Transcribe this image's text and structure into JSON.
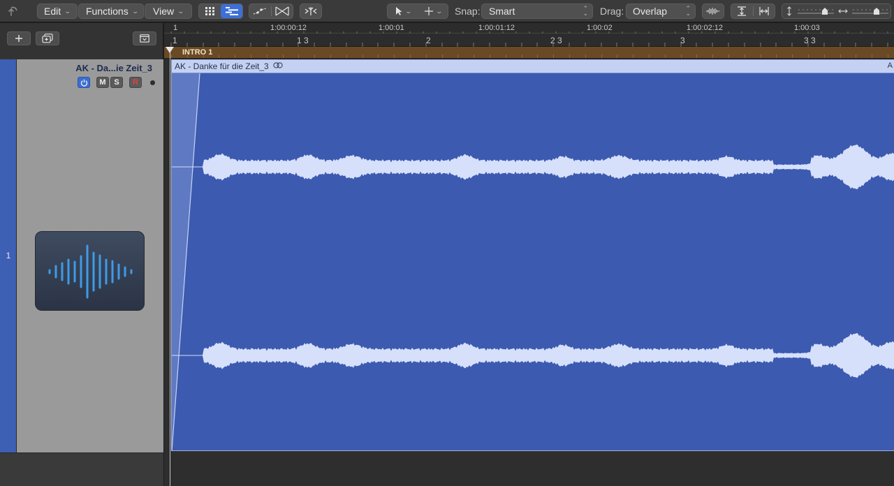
{
  "toolbar": {
    "edit_label": "Edit",
    "functions_label": "Functions",
    "view_label": "View",
    "snap_label": "Snap:",
    "snap_value": "Smart",
    "drag_label": "Drag:",
    "drag_value": "Overlap"
  },
  "ruler": {
    "time_labels": [
      "1",
      "1:00:00:12",
      "1:00:01",
      "1:00:01:12",
      "1:00:02",
      "1:00:02:12",
      "1:00:03"
    ],
    "bar_labels": [
      "1",
      "1 3",
      "2",
      "2 3",
      "3",
      "3 3"
    ]
  },
  "marker": {
    "label": "INTRO 1"
  },
  "track": {
    "number": "1",
    "name": "AK - Da...ie Zeit_3",
    "buttons": {
      "mute": "M",
      "solo": "S",
      "record": "R"
    }
  },
  "region": {
    "name": "AK - Danke für die Zeit_3",
    "edge_label": "A"
  },
  "colors": {
    "track_blue": "#3c5aaf",
    "region_header": "#c4d1f2",
    "marker_brown": "#6a4a24",
    "waveform": "#d6e0fb",
    "accent": "#3d6fd6"
  }
}
